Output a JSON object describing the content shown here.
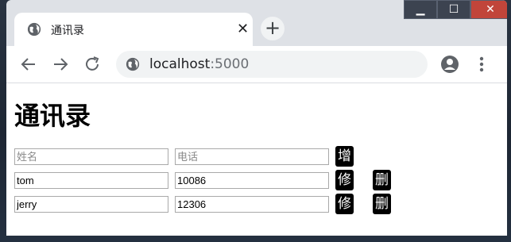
{
  "browser": {
    "tab_title": "通讯录",
    "url_host": "localhost",
    "url_port": ":5000"
  },
  "page": {
    "heading": "通讯录",
    "new_entry": {
      "name_placeholder": "姓名",
      "phone_placeholder": "电话",
      "add_label": "增加"
    },
    "contacts": [
      {
        "name": "tom",
        "phone": "10086",
        "edit_label": "修改",
        "delete_label": "删除"
      },
      {
        "name": "jerry",
        "phone": "12306",
        "edit_label": "修改",
        "delete_label": "删除"
      }
    ]
  },
  "theme": {
    "button_bg": "#000000",
    "button_text": "#ffffff",
    "chrome_frame": "#dee1e6",
    "close_button": "#c1453a"
  }
}
